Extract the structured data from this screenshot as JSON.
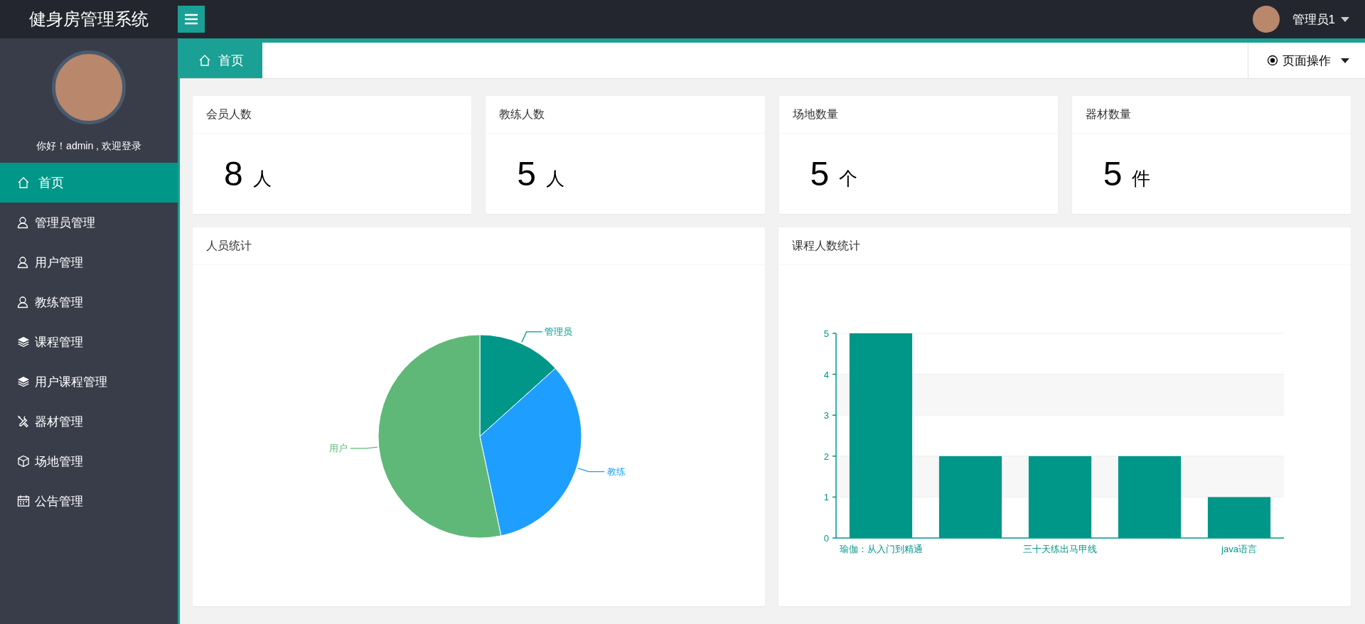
{
  "header": {
    "title": "健身房管理系统",
    "user": "管理员1"
  },
  "sidebar": {
    "greeting": "你好！admin , 欢迎登录",
    "items": [
      {
        "label": "首页",
        "selected": true
      },
      {
        "label": "管理员管理",
        "selected": false
      },
      {
        "label": "用户管理",
        "selected": false
      },
      {
        "label": "教练管理",
        "selected": false
      },
      {
        "label": "课程管理",
        "selected": false
      },
      {
        "label": "用户课程管理",
        "selected": false
      },
      {
        "label": "器材管理",
        "selected": false
      },
      {
        "label": "场地管理",
        "selected": false
      },
      {
        "label": "公告管理",
        "selected": false
      }
    ]
  },
  "tabs": [
    {
      "label": "首页",
      "selected": true
    }
  ],
  "page_actions": "页面操作",
  "stats": [
    {
      "title": "会员人数",
      "value": "8",
      "unit": "人"
    },
    {
      "title": "教练人数",
      "value": "5",
      "unit": "人"
    },
    {
      "title": "场地数量",
      "value": "5",
      "unit": "个"
    },
    {
      "title": "器材数量",
      "value": "5",
      "unit": "件"
    }
  ],
  "people_chart": {
    "title": "人员统计",
    "chart_data": {
      "type": "pie",
      "categories": [
        "管理员",
        "教练",
        "用户"
      ],
      "series": [
        {
          "colors": [
            "#009688",
            "#1e9fff",
            "#5fb878"
          ],
          "values": [
            13.33,
            33.33,
            53.34
          ]
        }
      ]
    }
  },
  "course_chart": {
    "title": "课程人数统计",
    "chart_data": {
      "type": "bar",
      "categories": [
        "瑜伽：从入门到精通",
        null,
        "三十天练出马甲线",
        null,
        "java语言"
      ],
      "ylim": [
        0,
        5
      ],
      "yticks": [
        0,
        1,
        2,
        3,
        4,
        5
      ],
      "grid": true,
      "series": [
        {
          "color": "#009688",
          "values": [
            5,
            2,
            2,
            2,
            1
          ]
        }
      ]
    }
  }
}
